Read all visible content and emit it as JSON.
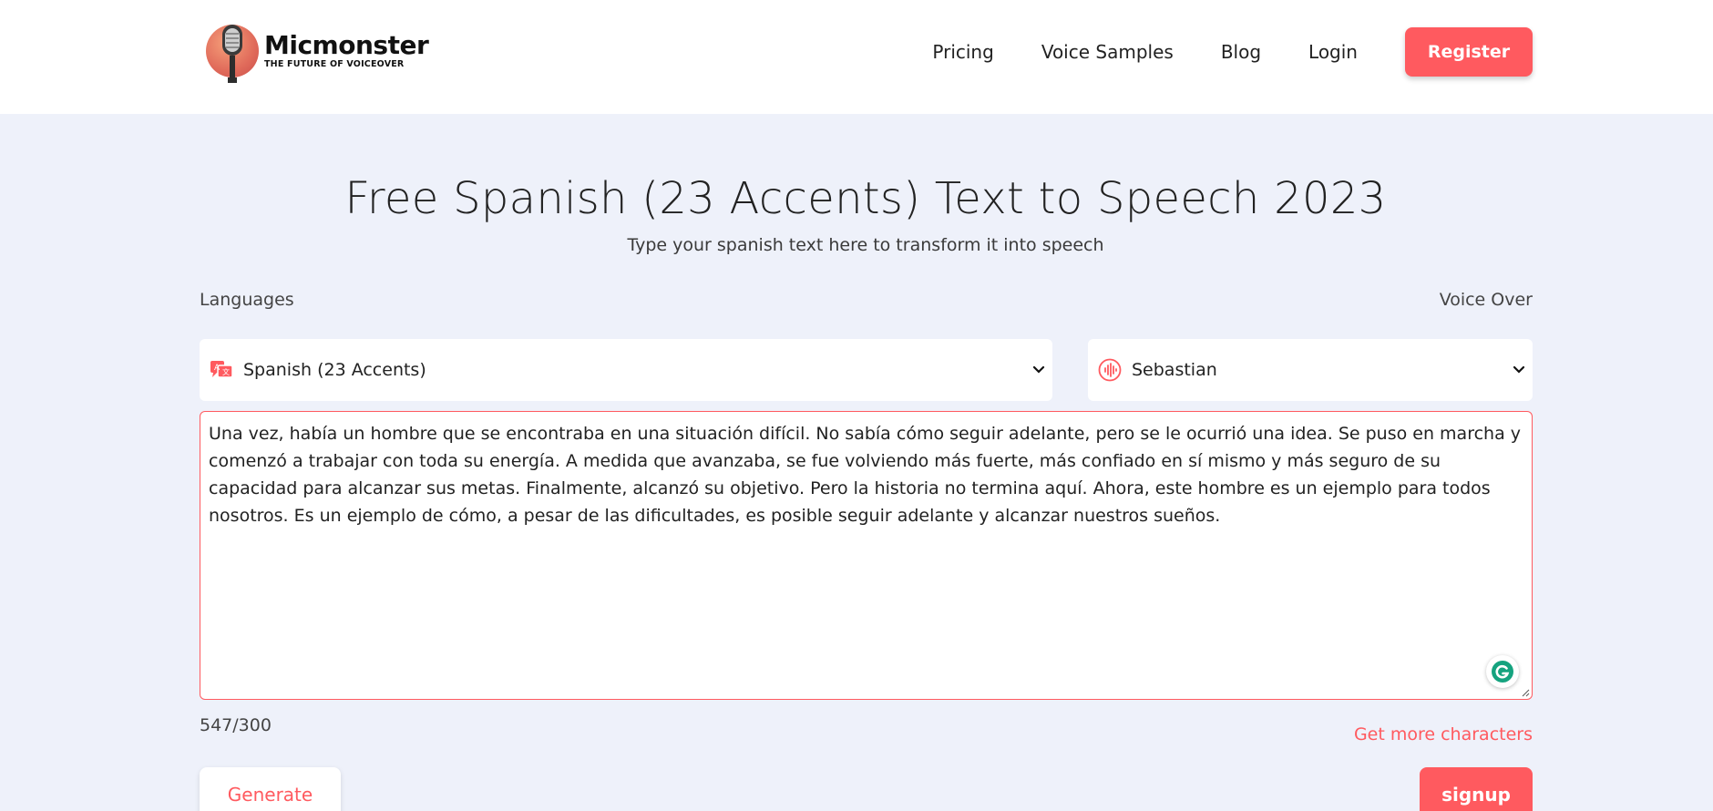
{
  "brand": {
    "name": "Micmonster",
    "tagline": "THE FUTURE OF VOICEOVER",
    "accent_color": "#ff5a5f"
  },
  "nav": {
    "items": [
      "Pricing",
      "Voice Samples",
      "Blog",
      "Login"
    ],
    "register_label": "Register"
  },
  "hero": {
    "title": "Free Spanish (23 Accents) Text to Speech 2023",
    "subtitle": "Type your spanish text here to transform it into speech"
  },
  "form": {
    "languages_label": "Languages",
    "voice_over_label": "Voice Over",
    "language_value": "Spanish (23 Accents)",
    "voice_value": "Sebastian",
    "language_icon": "translate-icon",
    "voice_icon": "sound-wave-icon",
    "text": "Una vez, había un hombre que se encontraba en una situación difícil. No sabía cómo seguir adelante, pero se le ocurrió una idea. Se puso en marcha y comenzó a trabajar con toda su energía. A medida que avanzaba, se fue volviendo más fuerte, más confiado en sí mismo y más seguro de su capacidad para alcanzar sus metas. Finalmente, alcanzó su objetivo. Pero la historia no termina aquí. Ahora, este hombre es un ejemplo para todos nosotros. Es un ejemplo de cómo, a pesar de las dificultades, es posible seguir adelante y alcanzar nuestros sueños.",
    "char_count": "547/300",
    "more_chars_label": "Get more characters",
    "generate_label": "Generate",
    "signup_label": "signup"
  }
}
